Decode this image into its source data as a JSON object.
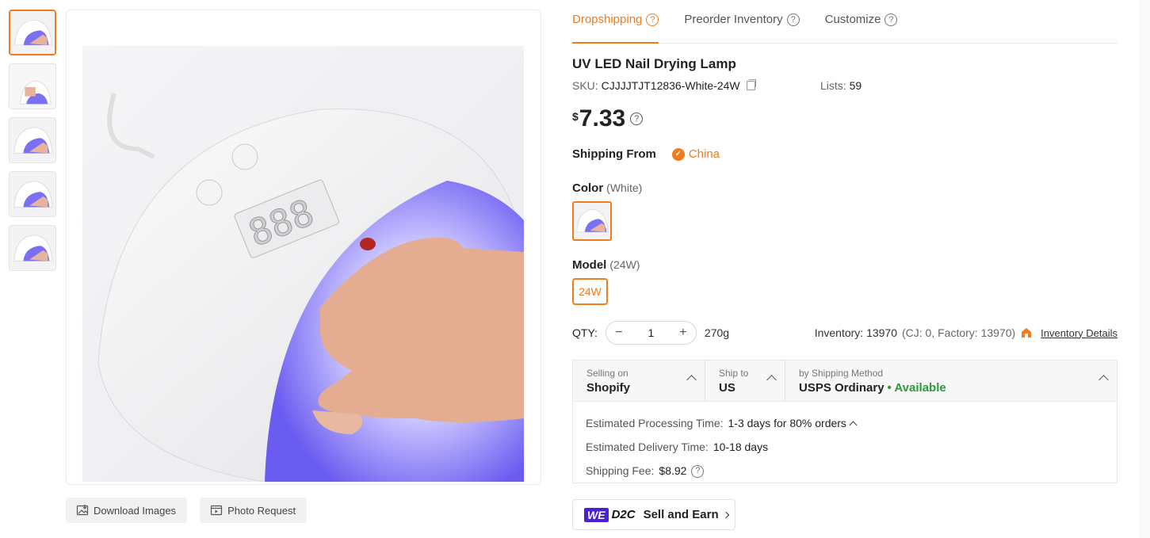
{
  "tabs": [
    {
      "label": "Dropshipping",
      "active": true
    },
    {
      "label": "Preorder Inventory",
      "active": false
    },
    {
      "label": "Customize",
      "active": false
    }
  ],
  "product": {
    "title": "UV LED Nail Drying Lamp",
    "sku_label": "SKU:",
    "sku": "CJJJJTJT12836-White-24W",
    "lists_label": "Lists:",
    "lists": "59",
    "currency": "$",
    "price": "7.33"
  },
  "shipping_from": {
    "label": "Shipping From",
    "value": "China"
  },
  "color": {
    "label": "Color",
    "selected": "(White)"
  },
  "model": {
    "label": "Model",
    "selected": "(24W)",
    "options": [
      "24W"
    ]
  },
  "qty": {
    "label": "QTY:",
    "value": "1",
    "weight": "270g",
    "inventory": "Inventory: 13970",
    "inventory_breakdown": "(CJ: 0, Factory: 13970)",
    "inventory_link": "Inventory Details"
  },
  "shipping": {
    "selling_on_label": "Selling on",
    "selling_on": "Shopify",
    "ship_to_label": "Ship to",
    "ship_to": "US",
    "method_label": "by Shipping Method",
    "method": "USPS Ordinary",
    "status": "• Available",
    "processing_label": "Estimated Processing Time:",
    "processing": "1-3 days for 80% orders",
    "delivery_label": "Estimated Delivery Time:",
    "delivery": "10-18 days",
    "fee_label": "Shipping Fee:",
    "fee": "$8.92"
  },
  "image_actions": {
    "download": "Download Images",
    "photo_request": "Photo Request"
  },
  "sell": {
    "we": "WE",
    "d2c": "D2C",
    "label": "Sell and Earn"
  },
  "colors": {
    "accent": "#f07c1e",
    "available": "#2e9a3a",
    "we_brand": "#4b1fd6",
    "uv_glow": "#6a5cf0"
  },
  "icons": [
    "help-circle-icon",
    "copy-icon",
    "check-circle-icon",
    "minus-icon",
    "plus-icon",
    "warehouse-icon",
    "chevron-up-icon",
    "chevron-right-icon",
    "image-download-icon",
    "video-request-icon"
  ]
}
